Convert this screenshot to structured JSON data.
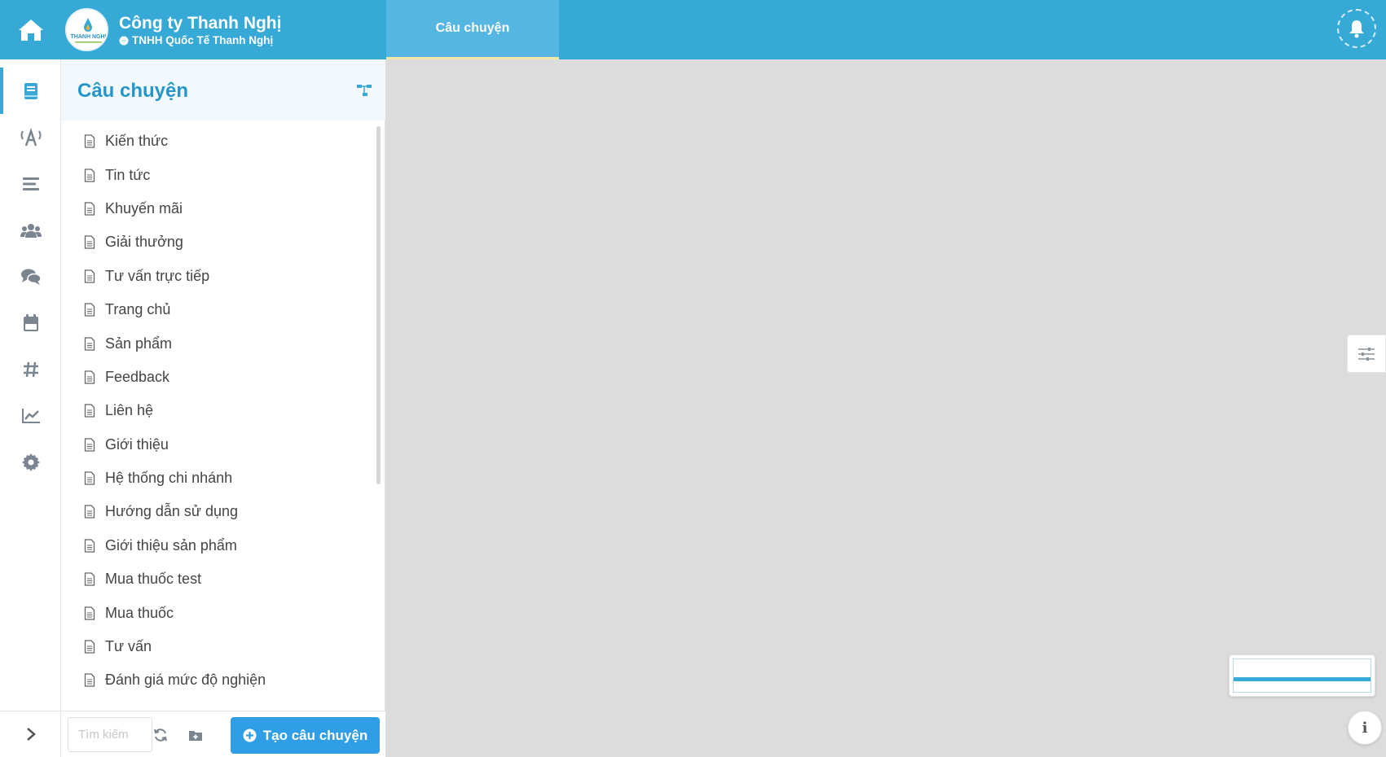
{
  "header": {
    "brand_name": "Công ty Thanh Nghị",
    "brand_subtitle": "TNHH Quốc Tế Thanh Nghị",
    "logo_text": "THANH NGHI",
    "active_tab": "Câu chuyện",
    "accent_color": "#36a9d6"
  },
  "rail": {
    "items": [
      {
        "icon": "book-icon",
        "active": true
      },
      {
        "icon": "broadcast-icon"
      },
      {
        "icon": "menu-lines-icon"
      },
      {
        "icon": "users-icon"
      },
      {
        "icon": "chat-icon"
      },
      {
        "icon": "calendar-icon"
      },
      {
        "icon": "hashtag-icon"
      },
      {
        "icon": "chart-icon"
      },
      {
        "icon": "gear-icon"
      }
    ],
    "expand_icon": "chevron-right-icon"
  },
  "panel": {
    "title": "Câu chuyện",
    "stories": [
      "Kiến thức",
      "Tin tức",
      "Khuyến mãi",
      "Giải thưởng",
      "Tư vấn trực tiếp",
      "Trang chủ",
      "Sản phẩm",
      "Feedback",
      "Liên hệ",
      "Giới thiệu",
      "Hệ thống chi nhánh",
      "Hướng dẫn sử dụng",
      "Giới thiệu sản phẩm",
      "Mua thuốc test",
      "Mua thuốc",
      "Tư vấn",
      "Đánh giá mức độ nghiện"
    ]
  },
  "footer": {
    "search_placeholder": "Tìm kiếm",
    "search_value": "",
    "create_label": "Tạo câu chuyện"
  },
  "widgets": {
    "info_label": "i"
  }
}
